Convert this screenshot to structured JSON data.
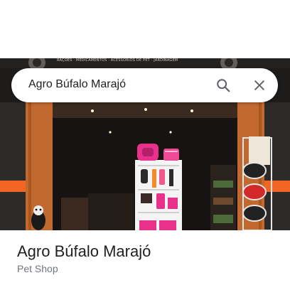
{
  "search": {
    "query": "Agro Búfalo Marajó"
  },
  "photo": {
    "sign_text": "RAÇÕES · MEDICAMENTOS · ACESSÓRIOS DE PET · JARDINAGEM",
    "accent_color": "#f26522",
    "wall_color": "#2a2826",
    "wood_color": "#c1692f"
  },
  "place": {
    "name": "Agro Búfalo Marajó",
    "category": "Pet Shop"
  },
  "icons": {
    "search": "search-icon",
    "close": "close-icon"
  }
}
